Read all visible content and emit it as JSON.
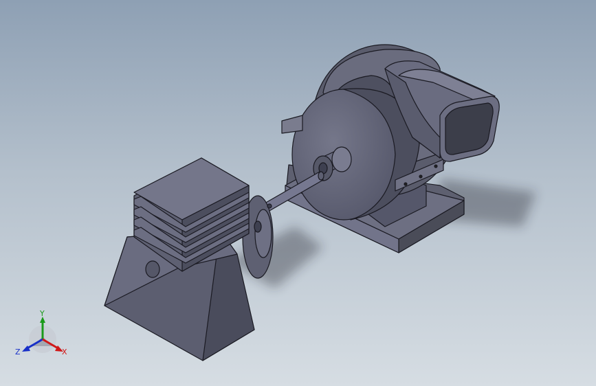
{
  "view": {
    "background_top": "#8ea0b4",
    "background_bottom": "#d6dde3",
    "model_color": "#6b6d7d"
  },
  "triad": {
    "x_label": "X",
    "y_label": "Y",
    "z_label": "Z",
    "x_color": "#d01818",
    "y_color": "#1a9a1a",
    "z_color": "#1830c8"
  },
  "model": {
    "parts": [
      "motor-housing",
      "shaft",
      "fan-housing",
      "outlet-duct",
      "base-plate"
    ]
  }
}
